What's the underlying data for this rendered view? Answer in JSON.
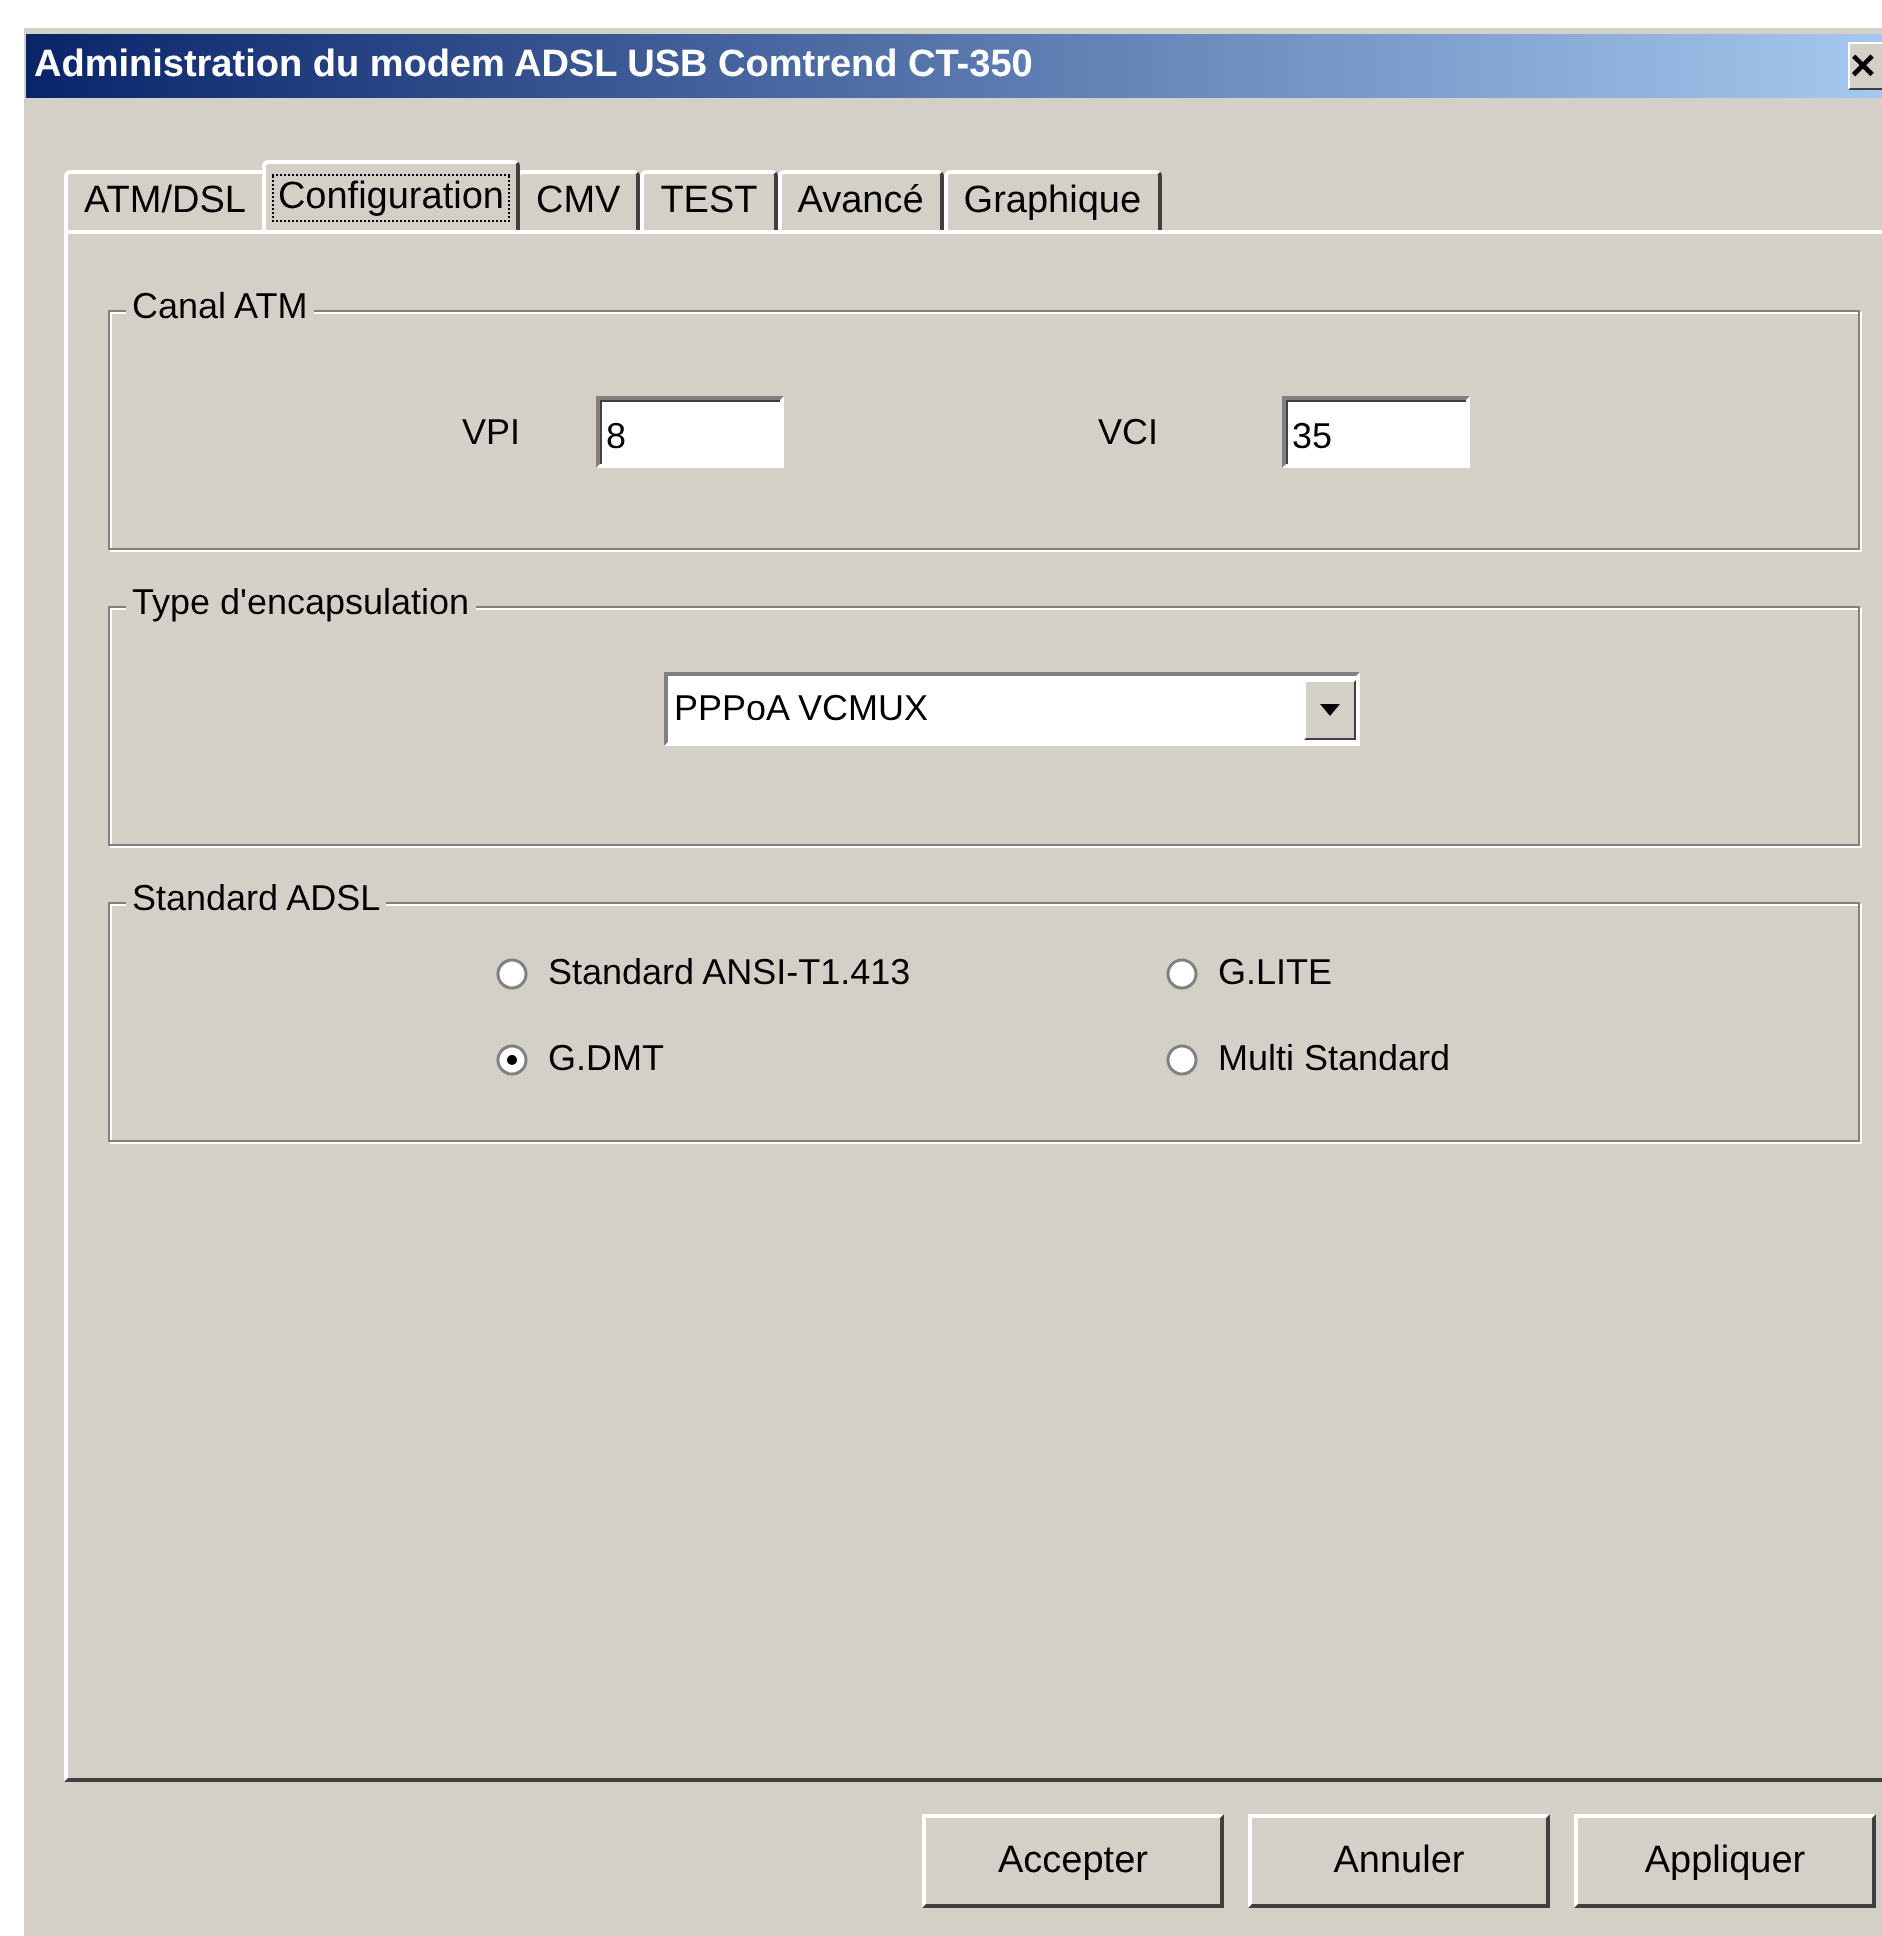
{
  "window": {
    "title": "Administration du modem ADSL USB Comtrend CT-350",
    "close": "×"
  },
  "tabs": [
    {
      "label": "ATM/DSL",
      "selected": false
    },
    {
      "label": "Configuration",
      "selected": true
    },
    {
      "label": "CMV",
      "selected": false
    },
    {
      "label": "TEST",
      "selected": false
    },
    {
      "label": "Avancé",
      "selected": false
    },
    {
      "label": "Graphique",
      "selected": false
    }
  ],
  "canal_atm": {
    "title": "Canal ATM",
    "fields": [
      {
        "label": "VPI",
        "value": "8"
      },
      {
        "label": "VCI",
        "value": "35"
      }
    ]
  },
  "encapsulation": {
    "title": "Type d'encapsulation",
    "value": "PPPoA VCMUX"
  },
  "standard_adsl": {
    "title": "Standard ADSL",
    "options": [
      {
        "label": "Standard ANSI-T1.413",
        "selected": false
      },
      {
        "label": "G.LITE",
        "selected": false
      },
      {
        "label": "G.DMT",
        "selected": true
      },
      {
        "label": "Multi Standard",
        "selected": false
      }
    ]
  },
  "buttons": [
    "Accepter",
    "Annuler",
    "Appliquer"
  ]
}
